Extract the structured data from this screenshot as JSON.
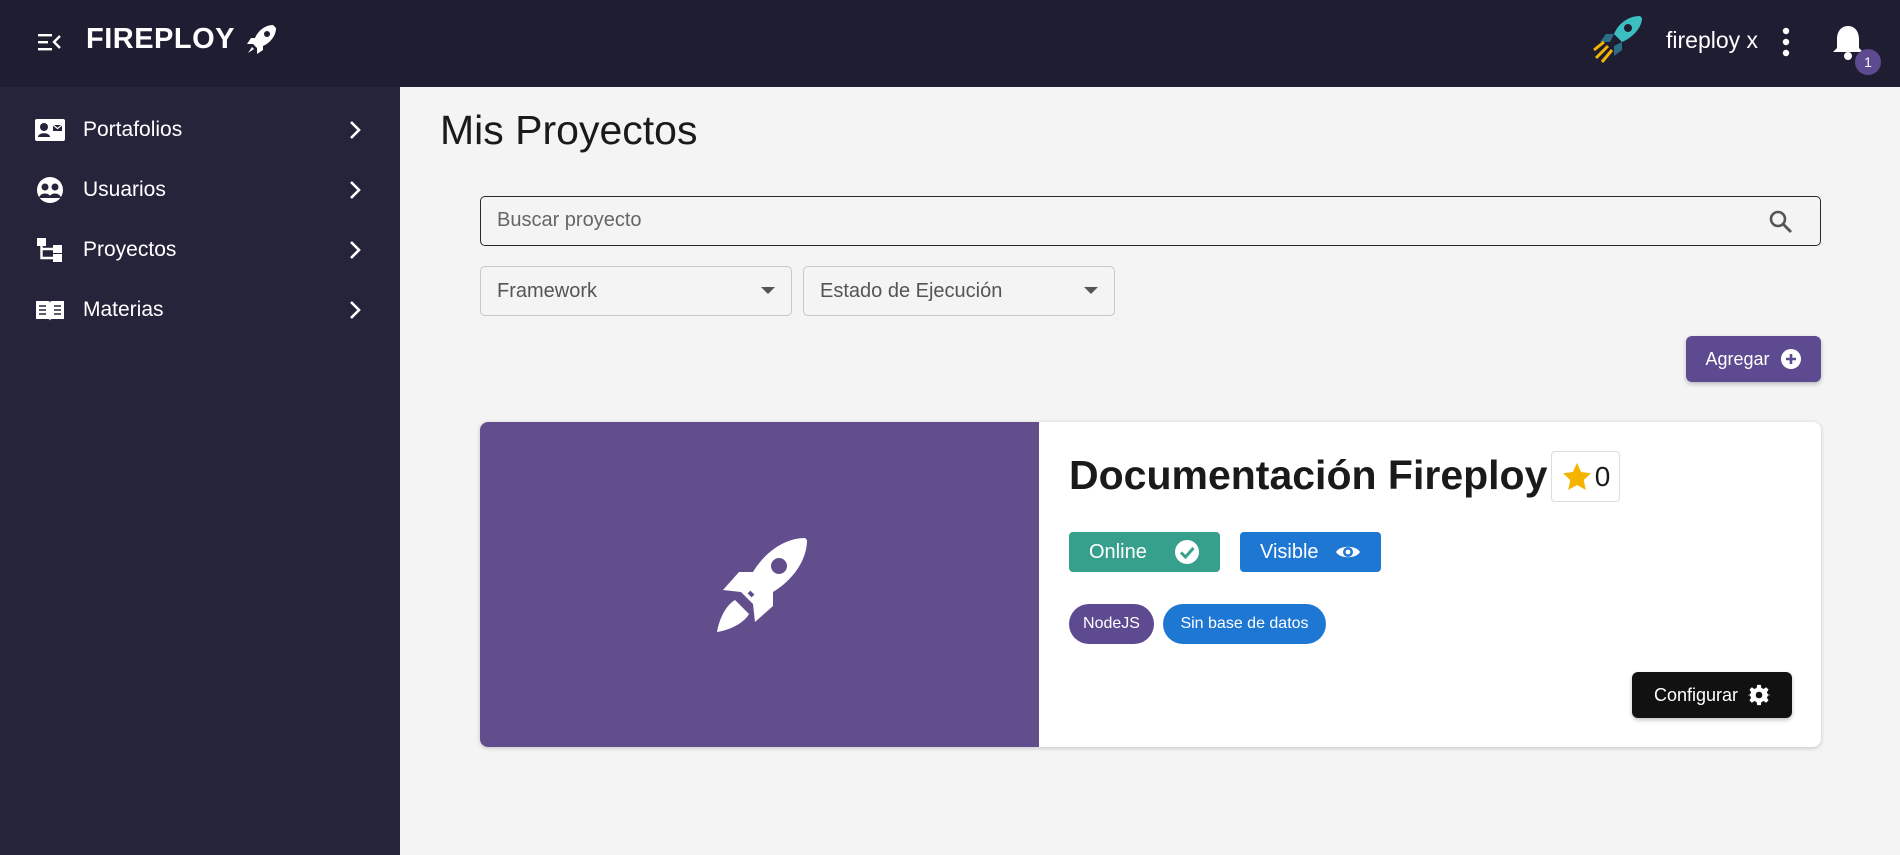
{
  "app": {
    "brand": "FIREPLOY",
    "user_name": "fireploy x",
    "notifications_count": "1"
  },
  "sidebar": {
    "items": [
      {
        "label": "Portafolios",
        "icon": "contact-card-icon"
      },
      {
        "label": "Usuarios",
        "icon": "users-icon"
      },
      {
        "label": "Proyectos",
        "icon": "tree-structure-icon"
      },
      {
        "label": "Materias",
        "icon": "open-book-icon"
      }
    ]
  },
  "main": {
    "title": "Mis Proyectos",
    "search": {
      "placeholder": "Buscar proyecto",
      "value": ""
    },
    "filters": [
      {
        "label": "Framework"
      },
      {
        "label": "Estado de Ejecución"
      }
    ],
    "add_button": "Agregar"
  },
  "project_card": {
    "title": "Documentación Fireploy",
    "stars": "0",
    "status": "Online",
    "visibility": "Visible",
    "tags": [
      "NodeJS",
      "Sin base de datos"
    ],
    "configure_button": "Configurar"
  },
  "colors": {
    "topbar": "#1f1d32",
    "sidebar": "#26243a",
    "accent_purple": "#5e4a91",
    "card_media": "#634e8d",
    "online_green": "#37a08c",
    "visible_blue": "#1f77d4",
    "star_yellow": "#f5b400"
  }
}
